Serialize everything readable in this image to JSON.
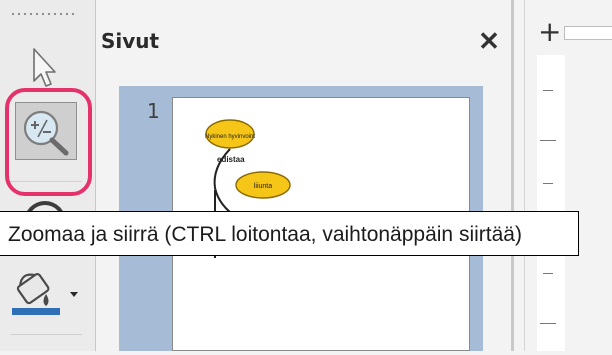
{
  "sidebar": {
    "title": "Sivut",
    "page_number": "1"
  },
  "mindmap": {
    "node_root": "Nykinen hyvinvoint",
    "connector": "edistaa",
    "node_child": "liiunta"
  },
  "tooltip": {
    "text": "Zoomaa ja siirrä (CTRL loitontaa, vaihtonäppäin siirtää)"
  },
  "icons": {
    "select_tool": "pointer-arrow-icon",
    "zoom_tool": "zoom-pan-icon",
    "fill_tool": "paint-bucket-icon",
    "close": "close-icon",
    "ruler_origin": "crosshair-icon"
  },
  "colors": {
    "highlight": "#e4326a",
    "node_fill": "#f5c518",
    "thumbnail_background": "#a6bcd6"
  }
}
